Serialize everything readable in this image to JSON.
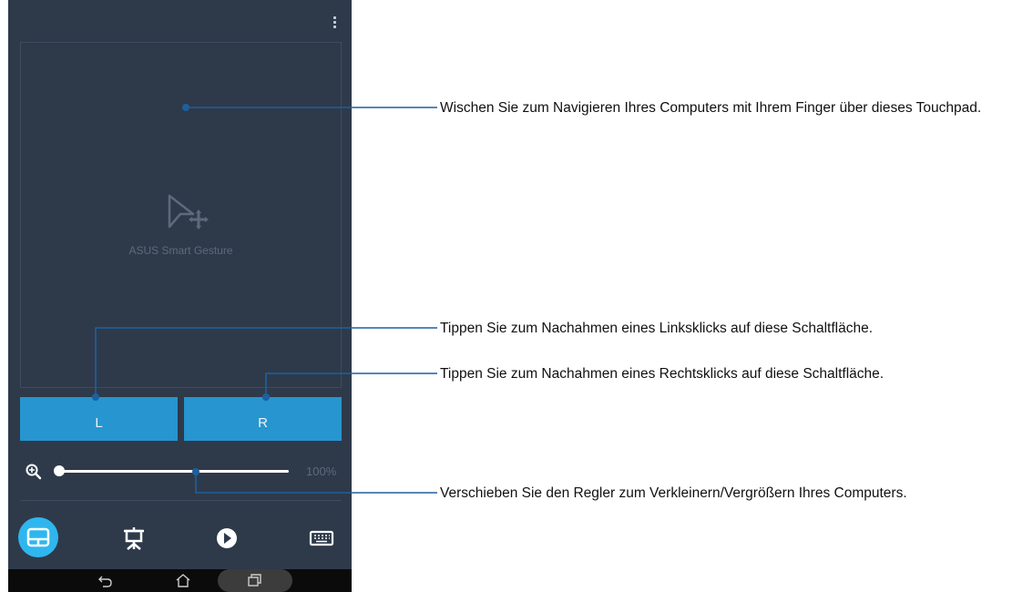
{
  "touchpad": {
    "app_name": "ASUS Smart Gesture"
  },
  "mouse_buttons": {
    "left_label": "L",
    "right_label": "R"
  },
  "zoom": {
    "value_text": "100%",
    "level_fraction": 0.0
  },
  "tabs": [
    {
      "name": "touchpad",
      "icon": "touchpad-icon",
      "active": true
    },
    {
      "name": "presentation",
      "icon": "presentation-icon",
      "active": false
    },
    {
      "name": "media",
      "icon": "play-icon",
      "active": false
    },
    {
      "name": "keyboard",
      "icon": "keyboard-icon",
      "active": false
    }
  ],
  "navbar": {
    "icons": [
      "back-icon",
      "home-icon",
      "recents-icon"
    ]
  },
  "callouts": {
    "touchpad": "Wischen Sie zum Navigieren Ihres Computers mit Ihrem Finger über dieses Touchpad.",
    "left_click": "Tippen Sie zum Nachahmen eines Linksklicks auf diese Schaltfläche.",
    "right_click": "Tippen Sie zum Nachahmen eines Rechtsklicks auf diese Schaltfläche.",
    "slider": "Verschieben Sie den Regler zum Verkleinern/Vergrößern Ihres Computers."
  },
  "colors": {
    "panel_bg": "#2e3a4a",
    "button_blue": "#2795cf",
    "active_tab": "#2fb6ef",
    "callout_line": "#1e5f9e"
  }
}
